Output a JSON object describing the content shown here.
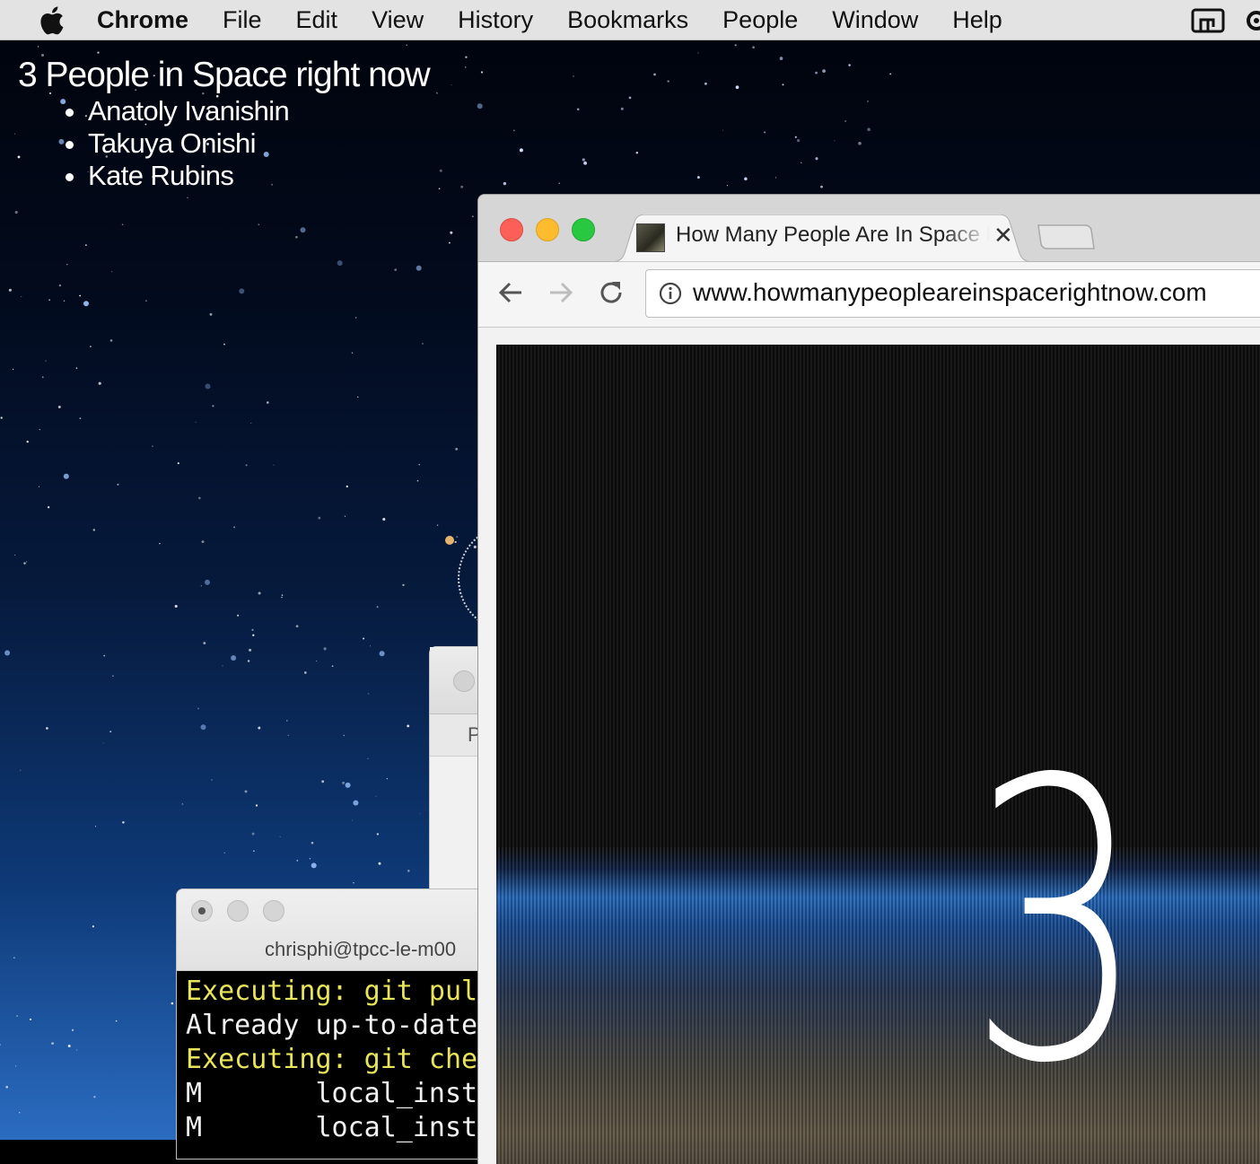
{
  "menubar": {
    "app_name": "Chrome",
    "items": [
      "File",
      "Edit",
      "View",
      "History",
      "Bookmarks",
      "People",
      "Window",
      "Help"
    ]
  },
  "overlay": {
    "title": "3 People in Space right now",
    "people": [
      "Anatoly Ivanishin",
      "Takuya Onishi",
      "Kate Rubins"
    ]
  },
  "background_window": {
    "partial_label": "P"
  },
  "terminal": {
    "title": "chrisphi@tpcc-le-m00",
    "lines": [
      {
        "text": "Executing: git pul",
        "highlight": true
      },
      {
        "text": "Already up-to-date",
        "highlight": false
      },
      {
        "text": "Executing: git che",
        "highlight": true
      },
      {
        "text": "M       local_inst",
        "highlight": false
      },
      {
        "text": "M       local_inst",
        "highlight": false
      }
    ]
  },
  "browser": {
    "tab_title": "How Many People Are In Space Right Now",
    "url": "www.howmanypeopleareinspacerightnow.com",
    "count": "3"
  },
  "colors": {
    "terminal_yellow": "#e9e55a",
    "close": "#fc5f57",
    "minimize": "#fdbc2e",
    "zoom": "#28c840"
  },
  "icons": [
    "apple-icon",
    "airplay-icon",
    "settings-icon",
    "back-icon",
    "forward-icon",
    "reload-icon",
    "info-icon",
    "close-tab-icon",
    "new-tab-icon",
    "favicon-icon"
  ]
}
